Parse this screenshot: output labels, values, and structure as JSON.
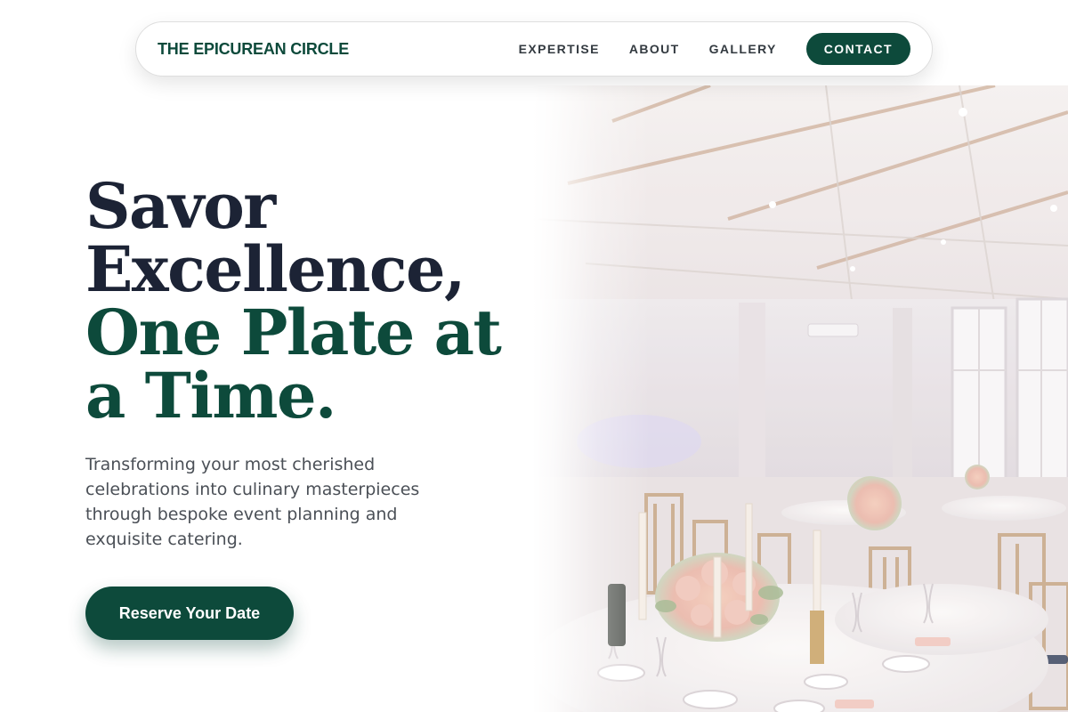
{
  "nav": {
    "brand": "THE EPICUREAN CIRCLE",
    "links": [
      {
        "label": "EXPERTISE"
      },
      {
        "label": "ABOUT"
      },
      {
        "label": "GALLERY"
      }
    ],
    "cta": "CONTACT"
  },
  "hero": {
    "headline_line1": "Savor",
    "headline_line2": "Excellence,",
    "headline_line3": "One Plate at",
    "headline_line4": "a Time.",
    "subtitle": "Transforming your most cherished celebrations into culinary masterpieces through bespoke event planning and exquisite catering.",
    "cta": "Reserve Your Date"
  },
  "colors": {
    "brand_green": "#0d4a3b",
    "headline_dark": "#1c2335",
    "body_text": "#4b5057",
    "nav_text": "#333a40"
  },
  "image": {
    "subject": "banquet-hall-table-setting-photo"
  }
}
